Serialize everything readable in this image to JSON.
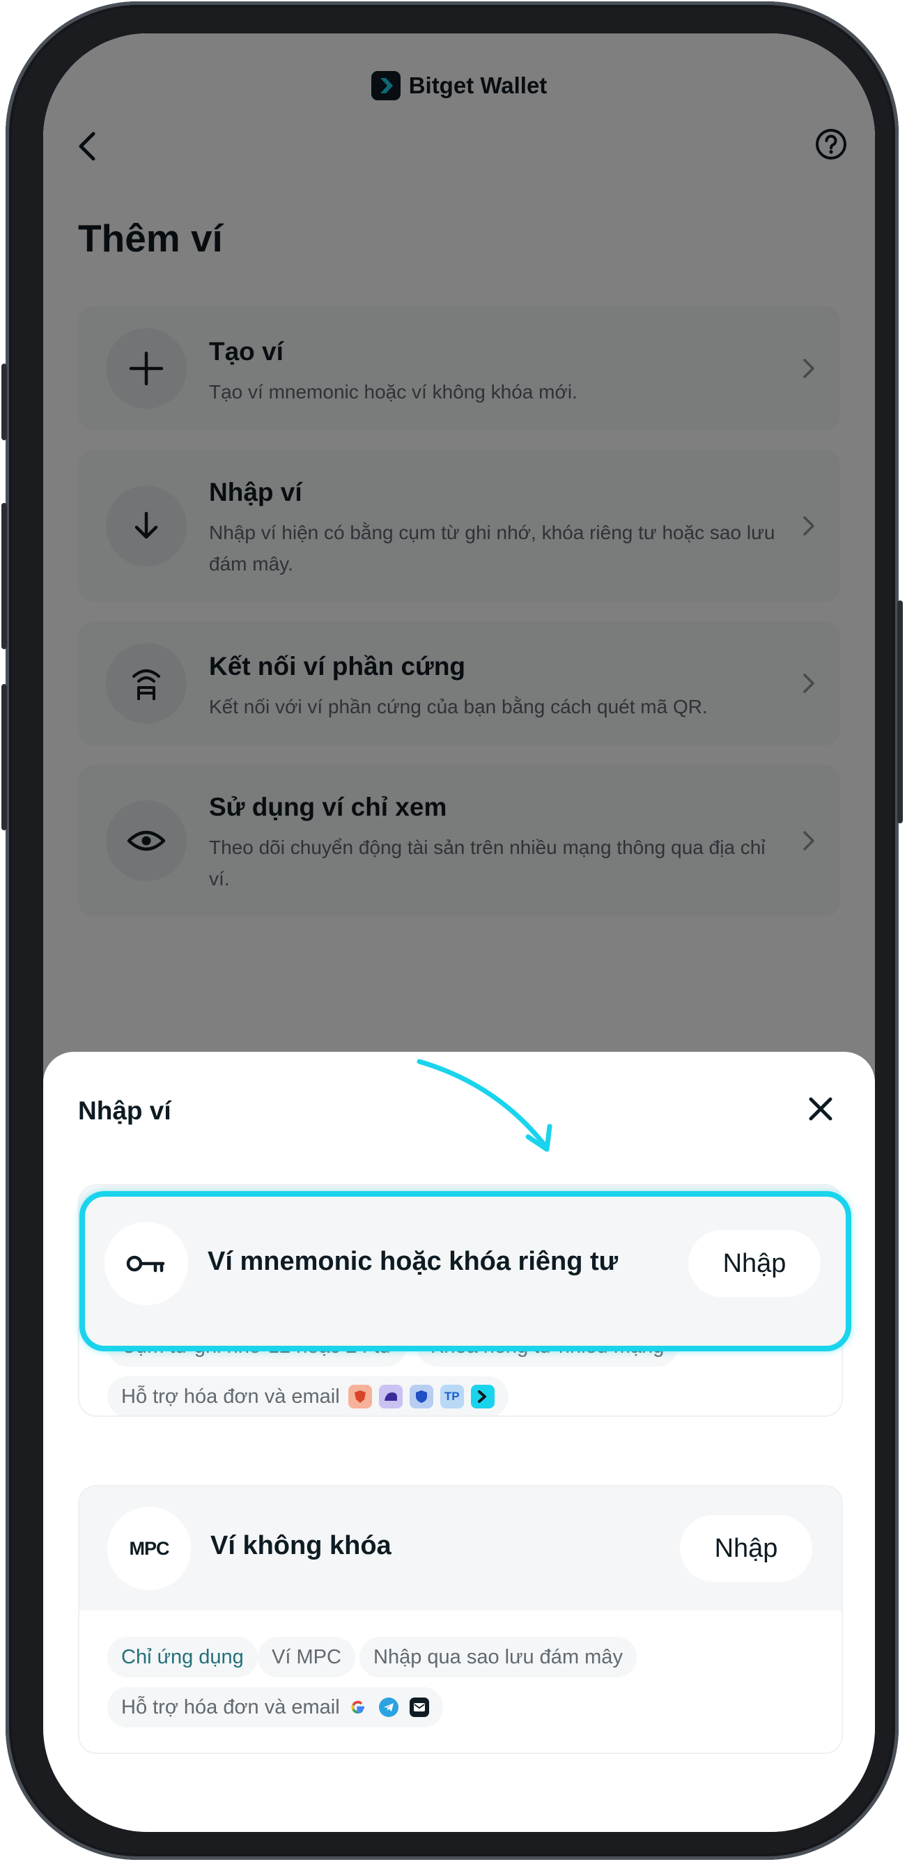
{
  "brand": {
    "name": "Bitget Wallet"
  },
  "page": {
    "title": "Thêm ví"
  },
  "options": [
    {
      "title": "Tạo ví",
      "desc": "Tạo ví mnemonic hoặc ví không khóa mới.",
      "icon": "plus-icon"
    },
    {
      "title": "Nhập ví",
      "desc": "Nhập ví hiện có bằng cụm từ ghi nhớ, khóa riêng tư hoặc sao lưu đám mây.",
      "icon": "arrow-down-icon"
    },
    {
      "title": "Kết nối ví phần cứng",
      "desc": "Kết nối với ví phần cứng của bạn bằng cách quét mã QR.",
      "icon": "hardware-wallet-icon"
    },
    {
      "title": "Sử dụng ví chỉ xem",
      "desc": "Theo dõi chuyển động tài sản trên nhiều mạng thông qua địa chỉ ví.",
      "icon": "eye-icon"
    }
  ],
  "sheet": {
    "title": "Nhập ví",
    "mnemonic": {
      "title": "Ví mnemonic hoặc khóa riêng tư",
      "button": "Nhập",
      "tags": [
        "Cụm từ ghi nhớ 12 hoặc 24 từ",
        "Khóa riêng tư nhiều mạng"
      ],
      "support": "Hỗ trợ hóa đơn và email",
      "badges": [
        "TP"
      ]
    },
    "keyless": {
      "icon_label": "MPC",
      "title": "Ví không khóa",
      "button": "Nhập",
      "tags": [
        "Chỉ ứng dụng",
        "Ví MPC",
        "Nhập qua sao lưu đám mây"
      ],
      "support": "Hỗ trợ hóa đơn và email"
    }
  },
  "colors": {
    "highlight": "#19d4ec",
    "teal_tag": "#23707a",
    "brand_dark": "#0e1b22"
  }
}
